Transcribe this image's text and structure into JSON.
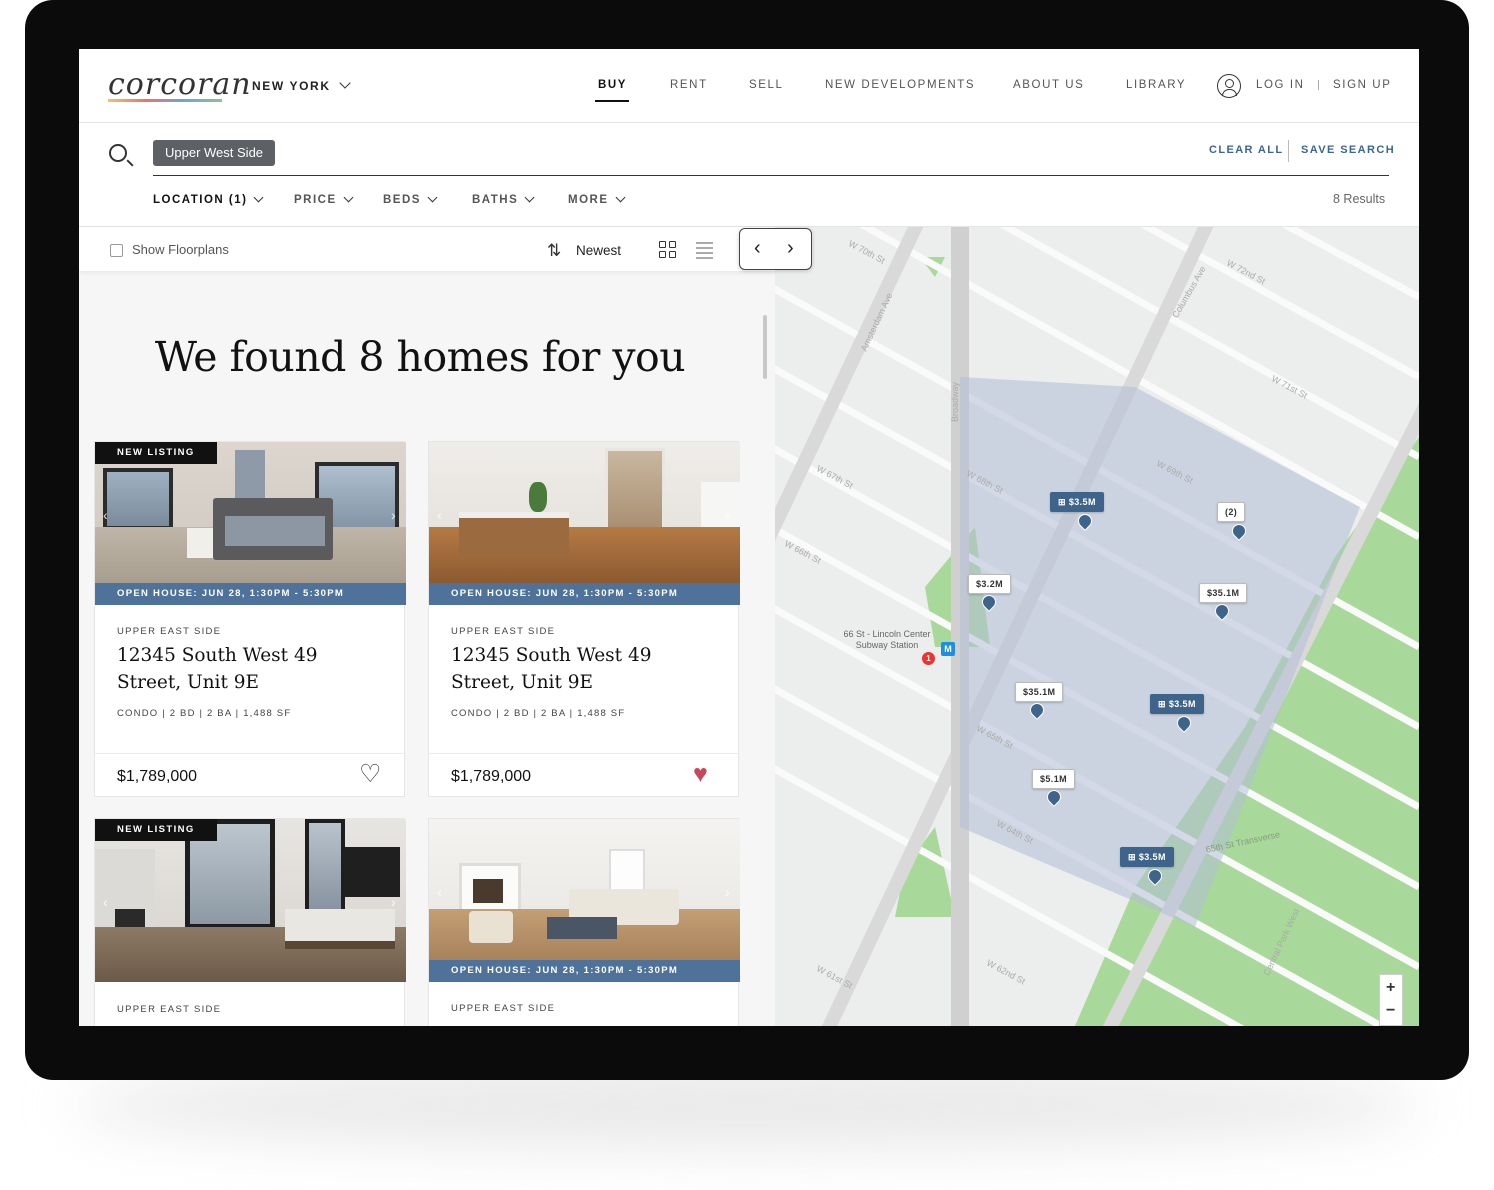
{
  "header": {
    "logo": "corcoran",
    "city": "NEW YORK",
    "nav": [
      "BUY",
      "RENT",
      "SELL",
      "NEW DEVELOPMENTS",
      "ABOUT US",
      "LIBRARY"
    ],
    "login": "LOG IN",
    "signup": "SIGN UP"
  },
  "search": {
    "chip": "Upper West Side",
    "clear_all": "CLEAR ALL",
    "save_search": "SAVE SEARCH"
  },
  "filters": [
    "LOCATION (1)",
    "PRICE",
    "BEDS",
    "BATHS",
    "MORE"
  ],
  "results_count": "8 Results",
  "toolbar": {
    "show_floorplans": "Show Floorplans",
    "sort": "Newest"
  },
  "headline": "We found 8 homes for you",
  "listings": [
    {
      "badge": "NEW LISTING",
      "open_house": "OPEN HOUSE: JUN 28, 1:30PM - 5:30PM",
      "neighborhood": "UPPER EAST SIDE",
      "address": "12345 South West 49 Street, Unit 9E",
      "specs": "CONDO | 2 BD | 2 BA | 1,488 SF",
      "price": "$1,789,000",
      "favorite": false
    },
    {
      "badge": "",
      "open_house": "OPEN HOUSE: JUN 28, 1:30PM - 5:30PM",
      "neighborhood": "UPPER EAST SIDE",
      "address": "12345 South West 49 Street, Unit 9E",
      "specs": "CONDO | 2 BD | 2 BA | 1,488 SF",
      "price": "$1,789,000",
      "favorite": true
    },
    {
      "badge": "NEW LISTING",
      "open_house": "",
      "neighborhood": "UPPER EAST SIDE",
      "address": "",
      "specs": "",
      "price": "",
      "favorite": false
    },
    {
      "badge": "",
      "open_house": "OPEN HOUSE: JUN 28, 1:30PM - 5:30PM",
      "neighborhood": "UPPER EAST SIDE",
      "address": "",
      "specs": "",
      "price": "",
      "favorite": false
    }
  ],
  "map": {
    "markers": [
      "$3.5M",
      "(2)",
      "$3.2M",
      "$35.1M",
      "$35.1M",
      "$3.5M",
      "$5.1M",
      "$3.5M"
    ],
    "station": "66 St - Lincoln Center Subway Station",
    "subway_icon": "M",
    "subway_badge": "1",
    "streets": [
      "W 70th St",
      "W 72nd St",
      "W 71st St",
      "W 69th St",
      "W 68th St",
      "W 67th St",
      "W 66th St",
      "W 65th St",
      "W 64th St",
      "W 62nd St",
      "W 61st St",
      "Broadway",
      "Amsterdam Ave",
      "Columbus Ave",
      "Central Park West",
      "65th St Transverse"
    ]
  },
  "colors": {
    "accent": "#4e7299",
    "marker": "#3f648c",
    "heart": "#c6485a",
    "park": "#a8d99a",
    "area": "#ccd3e2"
  }
}
